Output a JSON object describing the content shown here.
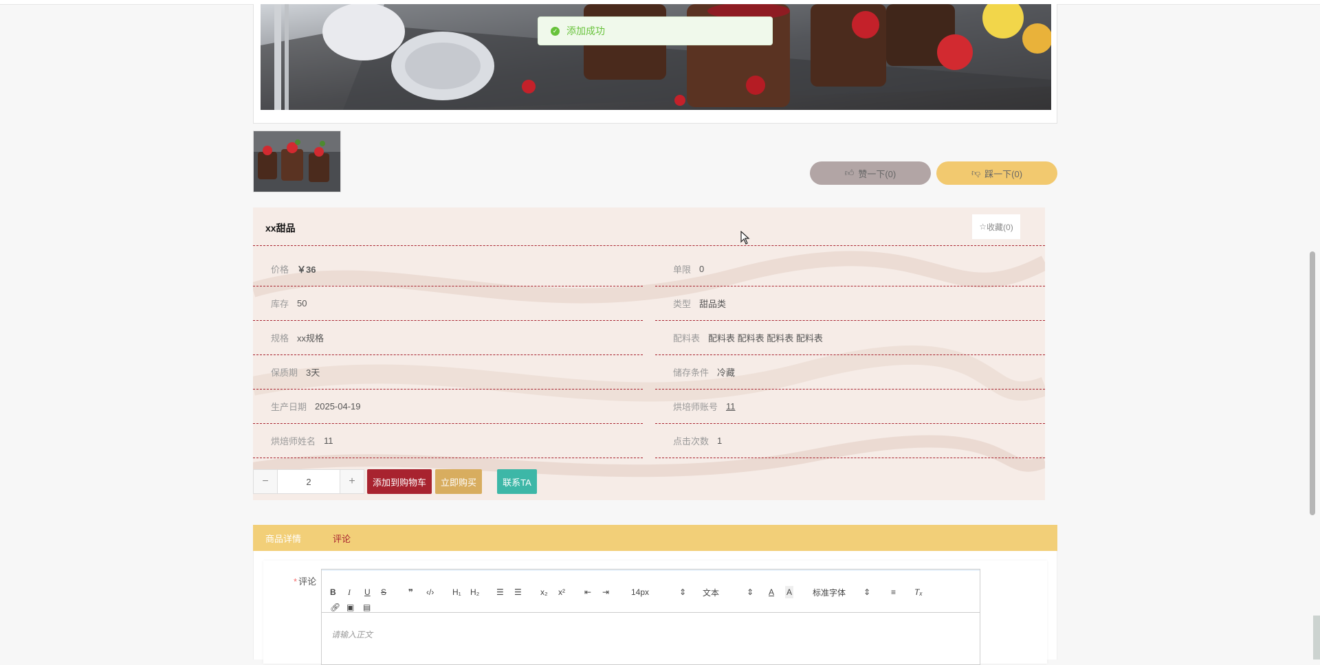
{
  "toast": {
    "message": "添加成功"
  },
  "votes": {
    "up_label": "赞一下(0)",
    "down_label": "踩一下(0)"
  },
  "product": {
    "title": "xx甜品",
    "favorite_label": "收藏(0)",
    "left_fields": [
      {
        "label": "价格",
        "value": "￥36"
      },
      {
        "label": "库存",
        "value": "50"
      },
      {
        "label": "规格",
        "value": "xx规格"
      },
      {
        "label": "保质期",
        "value": "3天"
      },
      {
        "label": "生产日期",
        "value": "2025-04-19"
      },
      {
        "label": "烘焙师姓名",
        "value": "11"
      }
    ],
    "right_fields": [
      {
        "label": "单限",
        "value": "0"
      },
      {
        "label": "类型",
        "value": "甜品类"
      },
      {
        "label": "配料表",
        "value": "配料表 配料表 配料表 配料表"
      },
      {
        "label": "储存条件",
        "value": "冷藏"
      },
      {
        "label": "烘培师账号",
        "value": "11"
      },
      {
        "label": "点击次数",
        "value": "1"
      }
    ]
  },
  "purchase": {
    "minus": "−",
    "quantity": "2",
    "plus": "+",
    "add_to_cart": "添加到购物车",
    "buy_now": "立即购买",
    "contact": "联系TA"
  },
  "tabs": [
    {
      "label": "商品详情"
    },
    {
      "label": "评论"
    }
  ],
  "comment": {
    "label": "评论",
    "placeholder": "请输入正文",
    "font_size": "14px",
    "text_style": "文本",
    "font_family": "标准字体"
  },
  "colors": {
    "accent": "#a8232f",
    "gold": "#f2cf78",
    "teal": "#3db7a7",
    "toast_green": "#67c23a"
  }
}
